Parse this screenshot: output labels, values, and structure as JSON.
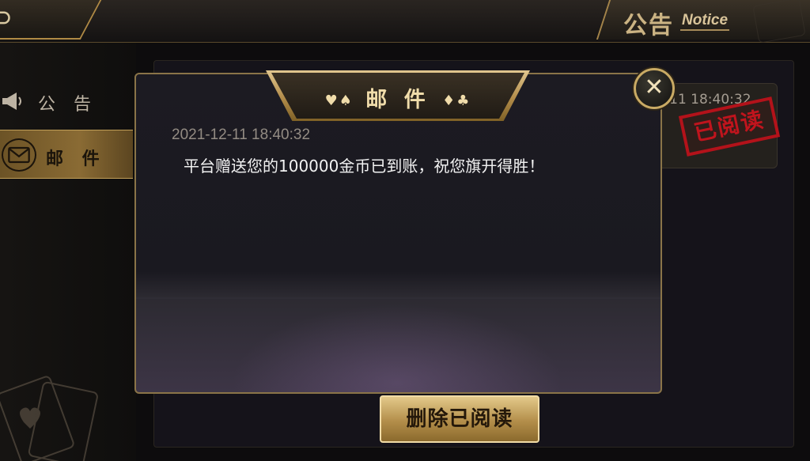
{
  "header": {
    "back_icon": "back-arrow-icon",
    "title_cn": "公告",
    "title_en": "Notice"
  },
  "sidebar": {
    "items": [
      {
        "label": "公 告",
        "icon": "megaphone-icon",
        "selected": false
      },
      {
        "label": "邮 件",
        "icon": "envelope-icon",
        "selected": true
      }
    ]
  },
  "background_list": {
    "row_time": "-11 18:40:32",
    "stamp": "已阅读"
  },
  "footer": {
    "delete_read_label": "删除已阅读"
  },
  "modal": {
    "title": "邮 件",
    "suits_left": "♥♠",
    "suits_right": "♦♣",
    "close_label": "✕",
    "time": "2021-12-11 18:40:32",
    "body": "平台赠送您的100000金币已到账，祝您旗开得胜！"
  },
  "colors": {
    "gold": "#c9aa64",
    "stamp_red": "#c0141d",
    "panel": "#1c1b22"
  }
}
